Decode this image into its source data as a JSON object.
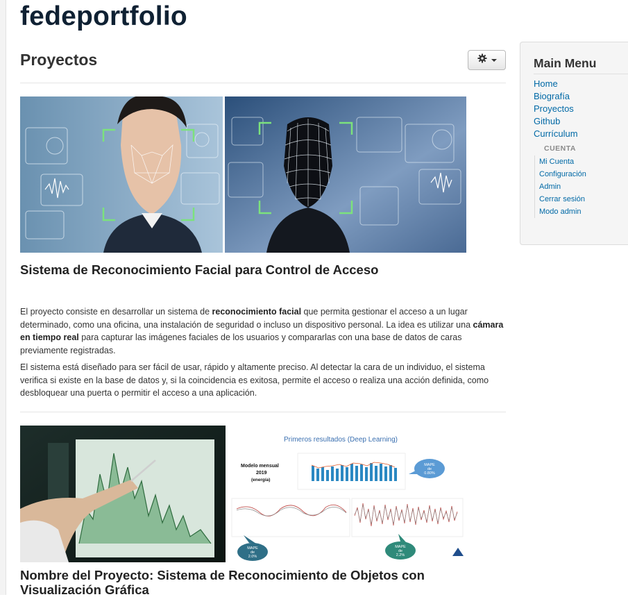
{
  "site": {
    "name": "fedeportfolio"
  },
  "page": {
    "title": "Proyectos"
  },
  "toolbar": {
    "gear_icon": "gear-icon",
    "caret_icon": "chevron-down-icon"
  },
  "articles": [
    {
      "title": "Sistema de Reconocimiento Facial para Control de Acceso",
      "p1": [
        {
          "text": "El proyecto consiste en desarrollar un sistema de ",
          "bold": false
        },
        {
          "text": "reconocimiento facial",
          "bold": true
        },
        {
          "text": " que permita gestionar el acceso a un lugar determinado, como una oficina, una instalación de seguridad o incluso un dispositivo personal. La idea es utilizar una ",
          "bold": false
        },
        {
          "text": "cámara en tiempo real",
          "bold": true
        },
        {
          "text": " para capturar las imágenes faciales de los usuarios y compararlas con una base de datos de caras previamente registradas.",
          "bold": false
        }
      ],
      "p2": "El sistema está diseñado para ser fácil de usar, rápido y altamente preciso. Al detectar la cara de un individuo, el sistema verifica si existe en la base de datos y, si la coincidencia es exitosa, permite el acceso o realiza una acción definida, como desbloquear una puerta o permitir el acceso a una aplicación."
    },
    {
      "title": "Nombre del Proyecto: Sistema de Reconocimiento de Objetos con Visualización Gráfica",
      "figure": {
        "heading": "Primeros resultados (Deep Learning)",
        "model_label_1": "Modelo mensual",
        "model_label_2": "2019",
        "model_label_3": "(energía)",
        "mape_1": [
          "MAPE",
          "de",
          "0.80%"
        ],
        "mape_2": [
          "MAPE",
          "de",
          "2.0%"
        ],
        "mape_3": [
          "MAPE",
          "de",
          "2.2%"
        ]
      }
    }
  ],
  "sidebar": {
    "title": "Main Menu",
    "items": [
      "Home",
      "Biografía",
      "Proyectos",
      "Github",
      "Currículum"
    ],
    "sub_header": "CUENTA",
    "sub_items": [
      "Mi Cuenta",
      "Configuración",
      "Admin",
      "Cerrar sesión",
      "Modo admin"
    ]
  }
}
